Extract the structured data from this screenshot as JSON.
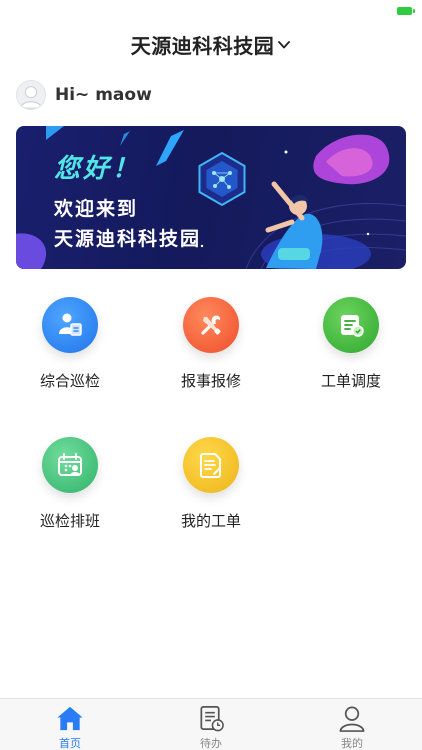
{
  "header": {
    "park_name": "天源迪科科技园"
  },
  "greeting": {
    "text": "Hi~ maow"
  },
  "banner": {
    "hello": "您好！",
    "line1": "欢迎来到",
    "line2": "天源迪科科技园"
  },
  "menu": [
    {
      "label": "综合巡检",
      "icon": "inspection-icon",
      "color": "#2f8af5"
    },
    {
      "label": "报事报修",
      "icon": "repair-tools-icon",
      "color": "#f4643b"
    },
    {
      "label": "工单调度",
      "icon": "dispatch-icon",
      "color": "#3fbb40"
    },
    {
      "label": "巡检排班",
      "icon": "schedule-calendar-icon",
      "color": "#43c27a"
    },
    {
      "label": "我的工单",
      "icon": "my-order-icon",
      "color": "#f3c21e"
    }
  ],
  "tabs": [
    {
      "label": "首页",
      "icon": "home-icon",
      "active": true
    },
    {
      "label": "待办",
      "icon": "todo-icon",
      "active": false
    },
    {
      "label": "我的",
      "icon": "profile-icon",
      "active": false
    }
  ],
  "colors": {
    "accent": "#2a7cf6",
    "battery": "#2ecc40",
    "banner_bg": "#151b60",
    "banner_cyan": "#52e5e6"
  }
}
